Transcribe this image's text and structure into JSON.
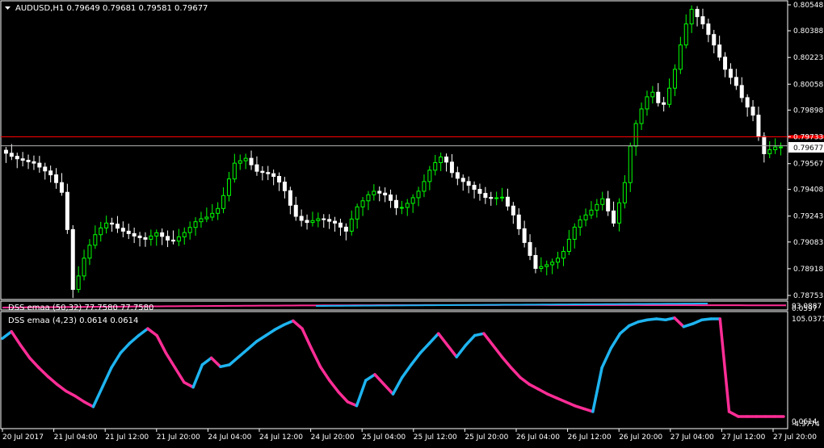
{
  "window": {
    "symbol_header": "AUDUSD,H1  0.79649 0.79681 0.79581 0.79677"
  },
  "colors": {
    "background": "#000000",
    "frame": "#ffffff",
    "bull_candle": "#00ff00",
    "bear_candle": "#ffffff",
    "red_line": "#ff0000",
    "dss_up": "#1eb4f0",
    "dss_down": "#ff2d96",
    "price_tag_bg": "#ffffff",
    "price_tag_text": "#000000"
  },
  "price_axis": {
    "labels": [
      "0.80548",
      "0.80388",
      "0.80223",
      "0.80058",
      "0.79898",
      "0.79733",
      "0.79567",
      "0.79408",
      "0.79243",
      "0.79083",
      "0.78918",
      "0.78753"
    ],
    "current_price": "0.79677",
    "red_marker_price": 0.79733
  },
  "indicator1": {
    "label": "DSS emaa (50,32) 77.7580 77.7580",
    "scale_labels": [
      "93.0887",
      "0.0597"
    ]
  },
  "indicator2": {
    "label": "DSS emaa (4,23) 0.0614 0.0614",
    "scale_top": "105.0371",
    "scale_bottom": "0.0614",
    "scale_bottom2": "-4.9774"
  },
  "time_axis": {
    "labels": [
      "20 Jul 2017",
      "21 Jul 04:00",
      "21 Jul 12:00",
      "21 Jul 20:00",
      "24 Jul 04:00",
      "24 Jul 12:00",
      "24 Jul 20:00",
      "25 Jul 04:00",
      "25 Jul 12:00",
      "25 Jul 20:00",
      "26 Jul 04:00",
      "26 Jul 12:00",
      "26 Jul 20:00",
      "27 Jul 04:00",
      "27 Jul 12:00",
      "27 Jul 20:00"
    ]
  },
  "chart_data": {
    "type": "candlestick",
    "price_range": [
      0.7867,
      0.8056
    ],
    "dss_fast": {
      "range": [
        0,
        105.0371
      ],
      "values": [
        85,
        92,
        78,
        65,
        55,
        46,
        38,
        31,
        26,
        20,
        15,
        35,
        55,
        70,
        80,
        88,
        95,
        88,
        70,
        55,
        40,
        35,
        58,
        65,
        56,
        58,
        66,
        74,
        82,
        88,
        94,
        99,
        103,
        95,
        75,
        56,
        42,
        30,
        20,
        16,
        42,
        48,
        38,
        28,
        45,
        58,
        70,
        80,
        90,
        78,
        66,
        78,
        88,
        90,
        78,
        66,
        55,
        45,
        38,
        33,
        28,
        24,
        20,
        16,
        13,
        10,
        55,
        75,
        90,
        98,
        102,
        104,
        105,
        104,
        106,
        97,
        100,
        104,
        105,
        105,
        10,
        5,
        5,
        5,
        5,
        5,
        5
      ],
      "up": [
        true,
        true,
        false,
        false,
        false,
        false,
        false,
        false,
        false,
        false,
        false,
        true,
        true,
        true,
        true,
        true,
        true,
        false,
        false,
        false,
        false,
        false,
        true,
        true,
        false,
        true,
        true,
        true,
        true,
        true,
        true,
        true,
        true,
        false,
        false,
        false,
        false,
        false,
        false,
        false,
        true,
        true,
        false,
        false,
        true,
        true,
        true,
        true,
        true,
        false,
        false,
        true,
        true,
        true,
        false,
        false,
        false,
        false,
        false,
        false,
        false,
        false,
        false,
        false,
        false,
        false,
        true,
        true,
        true,
        true,
        true,
        true,
        true,
        true,
        true,
        false,
        true,
        true,
        true,
        true,
        false,
        false,
        false,
        false,
        false,
        false,
        false
      ]
    },
    "dss_slow": {
      "range": [
        0.0597,
        93.0887
      ],
      "note_hidden": ""
    }
  }
}
